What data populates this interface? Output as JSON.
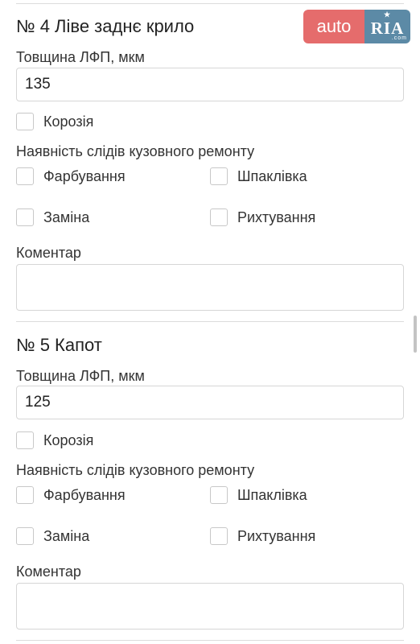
{
  "logo": {
    "auto": "auto",
    "ria": "RIA",
    "com": ".com"
  },
  "sections": [
    {
      "title": "№ 4 Ліве заднє крило",
      "thickness_label": "Товщина ЛФП, мкм",
      "thickness_value": "135",
      "corrosion_label": "Корозія",
      "repair_label": "Наявність слідів кузовного ремонту",
      "painting_label": "Фарбування",
      "putty_label": "Шпаклівка",
      "replacement_label": "Заміна",
      "straightening_label": "Рихтування",
      "comment_label": "Коментар",
      "comment_value": ""
    },
    {
      "title": "№ 5 Капот",
      "thickness_label": "Товщина ЛФП, мкм",
      "thickness_value": "125",
      "corrosion_label": "Корозія",
      "repair_label": "Наявність слідів кузовного ремонту",
      "painting_label": "Фарбування",
      "putty_label": "Шпаклівка",
      "replacement_label": "Заміна",
      "straightening_label": "Рихтування",
      "comment_label": "Коментар",
      "comment_value": ""
    }
  ],
  "colors": {
    "logo_auto": "#e56c6c",
    "logo_ria": "#5c8aa6",
    "border": "#d6d6d6"
  }
}
